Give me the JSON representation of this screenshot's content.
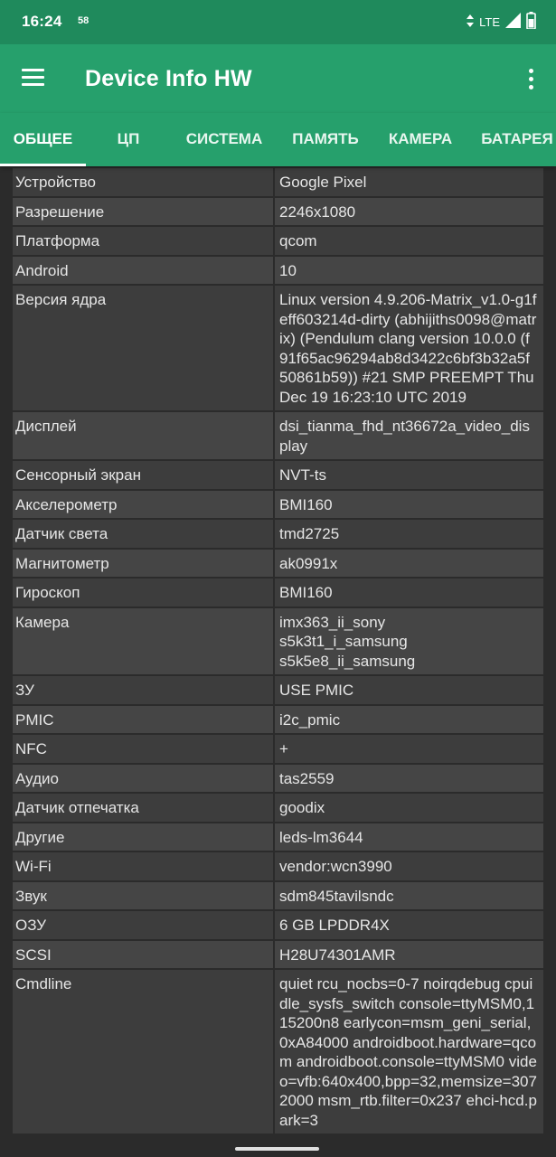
{
  "status_bar": {
    "time": "16:24",
    "notification": "58",
    "network": "LTE"
  },
  "app_bar": {
    "title": "Device Info HW",
    "menu_icon": "hamburger-menu-icon",
    "overflow_icon": "more-vert-icon"
  },
  "tabs": [
    {
      "label": "ОБЩЕЕ",
      "active": true
    },
    {
      "label": "ЦП"
    },
    {
      "label": "СИСТЕМА"
    },
    {
      "label": "ПАМЯТЬ"
    },
    {
      "label": "КАМЕРА"
    },
    {
      "label": "БАТАРЕЯ"
    }
  ],
  "rows": [
    {
      "label": "Устройство",
      "value": "Google Pixel"
    },
    {
      "label": "Разрешение",
      "value": "2246x1080"
    },
    {
      "label": "Платформа",
      "value": "qcom"
    },
    {
      "label": "Android",
      "value": "10"
    },
    {
      "label": "Версия ядра",
      "value": "Linux version 4.9.206-Matrix_v1.0-g1feff603214d-dirty (abhijiths0098@matrix) (Pendulum clang version 10.0.0 (f91f65ac96294ab8d3422c6bf3b32a5f50861b59)) #21 SMP PREEMPT Thu Dec 19 16:23:10 UTC 2019"
    },
    {
      "label": "Дисплей",
      "value": "dsi_tianma_fhd_nt36672a_video_display"
    },
    {
      "label": "Сенсорный экран",
      "value": "NVT-ts"
    },
    {
      "label": "Акселерометр",
      "value": "BMI160"
    },
    {
      "label": "Датчик света",
      "value": "tmd2725"
    },
    {
      "label": "Магнитометр",
      "value": "ak0991x"
    },
    {
      "label": "Гироскоп",
      "value": "BMI160"
    },
    {
      "label": "Камера",
      "value": "imx363_ii_sony\ns5k3t1_i_samsung\ns5k5e8_ii_samsung"
    },
    {
      "label": "ЗУ",
      "value": "USE PMIC"
    },
    {
      "label": "PMIC",
      "value": "i2c_pmic"
    },
    {
      "label": "NFC",
      "value": "+"
    },
    {
      "label": "Аудио",
      "value": "tas2559"
    },
    {
      "label": "Датчик отпечатка",
      "value": "goodix"
    },
    {
      "label": "Другие",
      "value": "leds-lm3644"
    },
    {
      "label": "Wi-Fi",
      "value": "vendor:wcn3990"
    },
    {
      "label": "Звук",
      "value": "sdm845tavilsndc"
    },
    {
      "label": "ОЗУ",
      "value": "6 GB LPDDR4X"
    },
    {
      "label": "SCSI",
      "value": "H28U74301AMR"
    },
    {
      "label": "Cmdline",
      "value": "quiet rcu_nocbs=0-7 noirqdebug cpuidle_sysfs_switch console=ttyMSM0,115200n8 earlycon=msm_geni_serial,0xA84000 androidboot.hardware=qcom androidboot.console=ttyMSM0 video=vfb:640x400,bpp=32,memsize=3072000 msm_rtb.filter=0x237 ehci-hcd.park=3"
    }
  ]
}
